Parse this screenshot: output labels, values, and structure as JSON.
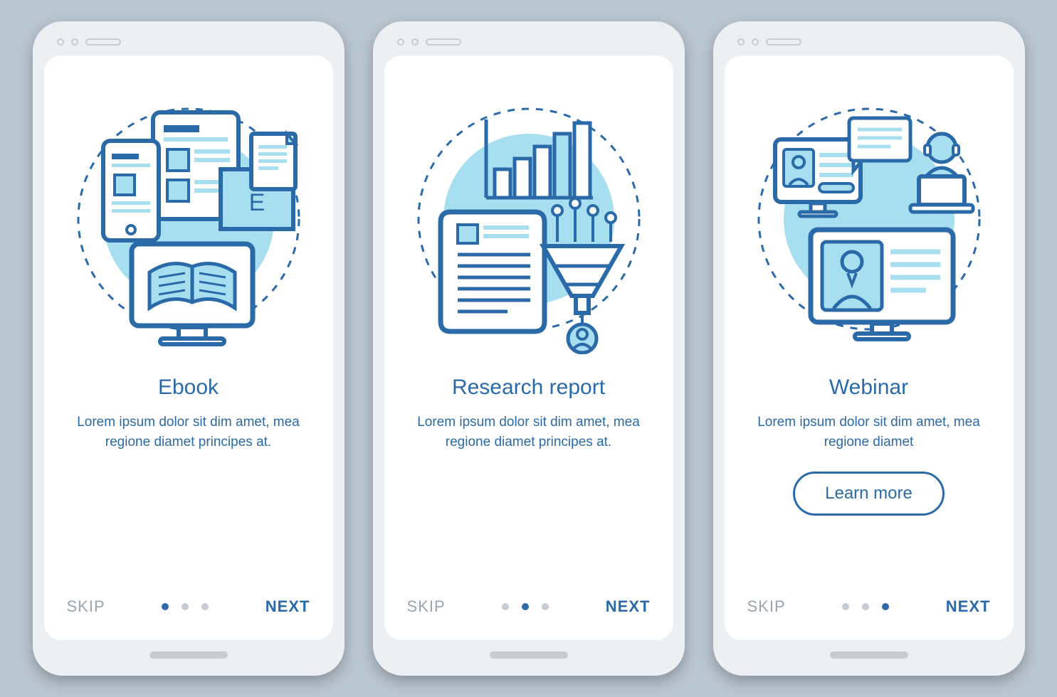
{
  "colors": {
    "bg": "#b9c5cf",
    "phone": "#edf0f2",
    "stroke": "#2b6aa8",
    "light_fill": "#a8dff0",
    "muted": "#9aa4ae",
    "dot_inactive": "#c6ccd2"
  },
  "screens": [
    {
      "illustration": "ebook-illustration",
      "title": "Ebook",
      "description": "Lorem ipsum dolor sit dim amet, mea regione diamet principes at.",
      "skip": "SKIP",
      "next": "NEXT",
      "activeDot": 0,
      "hasCta": false
    },
    {
      "illustration": "research-report-illustration",
      "title": "Research report",
      "description": "Lorem ipsum dolor sit dim amet, mea regione diamet principes at.",
      "skip": "SKIP",
      "next": "NEXT",
      "activeDot": 1,
      "hasCta": false
    },
    {
      "illustration": "webinar-illustration",
      "title": "Webinar",
      "description": "Lorem ipsum dolor sit dim amet, mea regione diamet",
      "skip": "SKIP",
      "next": "NEXT",
      "activeDot": 2,
      "hasCta": true,
      "cta": "Learn more"
    }
  ]
}
